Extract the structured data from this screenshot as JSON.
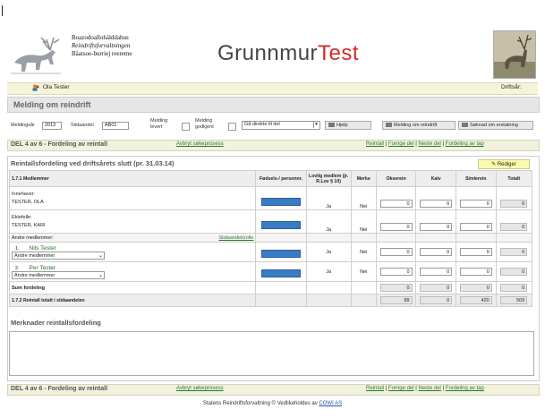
{
  "logo": {
    "line1": "Boazodoallohálddahus",
    "line2": "Reindriftsforvaltningen",
    "line3": "Båatsoe-burriej reereme"
  },
  "brand": {
    "part1": "Grunnmur",
    "part2": "Test"
  },
  "user": {
    "name": "Ola Tester",
    "driftsar_label": "Driftsår:"
  },
  "section": {
    "title": "Melding om reindrift"
  },
  "toolbar": {
    "meldingsar_label": "Meldingsår",
    "meldingsar_value": "2013",
    "siidaandel_label": "Siidaandel",
    "siidaandel_value": "AB01",
    "melding_levert_label_1": "Melding",
    "melding_levert_label_2": "levert",
    "melding_godkjent_label_1": "Melding",
    "melding_godkjent_label_2": "godkjent",
    "goto_select_value": "Gå direkte til del",
    "help_button": "Hjelp",
    "melding_button": "Melding om reindrift",
    "soknad_button": "Søknad om erstatning"
  },
  "delbar": {
    "title": "DEL 4 av 6 - Fordeling av reintall",
    "avbryt": "Avbryt søkeprosess",
    "reintall": "Reintall",
    "forrige": "Forrige del",
    "neste": "Neste del",
    "fordeling": "Fordeling av tap",
    "sep": "|"
  },
  "panel": {
    "title": "Reintallsfordeling ved driftsårets slutt (pr. 31.03.14)",
    "rediger": "Rediger"
  },
  "table": {
    "headers": {
      "section": "1.7.1 Medlemmer",
      "fodsels": "Fødsels-/ personnr.",
      "lovlig": "Lovlig medlem (jr. R.Lov § 10)",
      "merke": "Merke",
      "okserein": "Okserein",
      "kalv": "Kalv",
      "simlerein": "Simlerein",
      "totalt": "Totalt"
    },
    "innehaver": {
      "label": "Innehaver:",
      "name": "TESTER, OLA",
      "lovlig": "Ja",
      "merke": "Nei",
      "okserein": "0",
      "kalv": "0",
      "simlerein": "0",
      "totalt": "0"
    },
    "ektefelle": {
      "label": "Ektefelle:",
      "name": "TESTER, KARI",
      "lovlig": "Ja",
      "merke": "Nei",
      "okserein": "0",
      "kalv": "0",
      "simlerein": "0",
      "totalt": "0"
    },
    "andre_label": "Andre medlemmer:",
    "siidaandelsrolle": "Siidaandelsrolle",
    "members": [
      {
        "nr": "1.",
        "name": "Nils Tester",
        "role": "Andre medlemmer",
        "lovlig": "Ja",
        "merke": "Nei",
        "okserein": "0",
        "kalv": "0",
        "simlerein": "0",
        "totalt": "0"
      },
      {
        "nr": "2.",
        "name": "Per Tester",
        "role": "Andre medlemmer",
        "lovlig": "Ja",
        "merke": "Nei",
        "okserein": "0",
        "kalv": "0",
        "simlerein": "0",
        "totalt": "0"
      }
    ],
    "sum": {
      "label": "Sum fordeling",
      "okserein": "0",
      "kalv": "0",
      "simlerein": "0",
      "totalt": "0"
    },
    "reintall": {
      "label": "1.7.2 Reintall totalt i siidaandelen",
      "okserein": "89",
      "kalv": "0",
      "simlerein": "420",
      "totalt": "509"
    }
  },
  "merknader": {
    "title": "Merknader reintallsfordeling"
  },
  "footer": {
    "text": "Statens Reindriftsforvaltning © Vedlikeholdes av ",
    "link": "COWI AS"
  },
  "colors": {
    "accent_red": "#d42a2a",
    "link_green": "#2a7a2a",
    "bar_blue": "#3a7cc4",
    "delbar_bg": "#f1f1de"
  }
}
